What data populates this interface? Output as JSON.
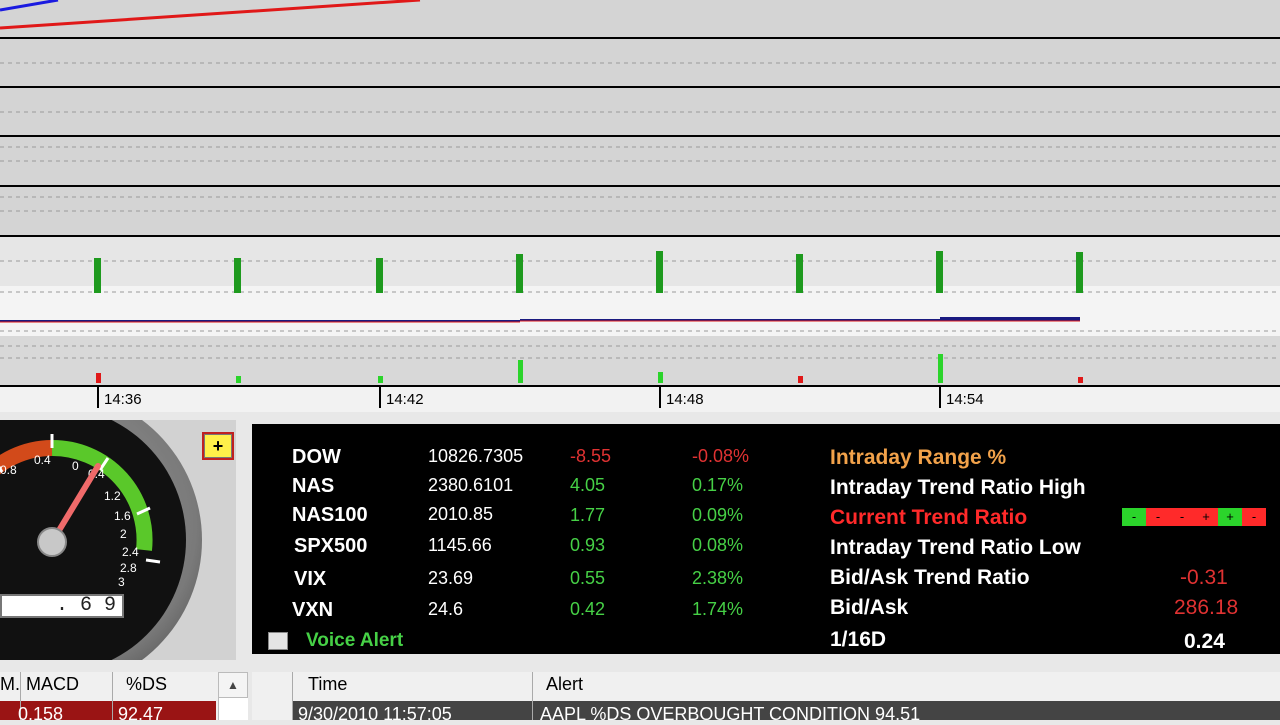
{
  "chart_data": {
    "type": "bar",
    "x_ticks": [
      "14:36",
      "14:42",
      "14:48",
      "14:54"
    ]
  },
  "gauge": {
    "readout": ". 6 9",
    "scale_labels": [
      "0.8",
      "0.4",
      "0",
      "0.4",
      "1.2",
      "1.6",
      "2",
      "2.4",
      "2.8",
      "3"
    ],
    "alarm_symbol": "+"
  },
  "market": {
    "rows": [
      {
        "symbol": "DOW",
        "value": "10826.7305",
        "change": "-8.55",
        "pct": "-0.08%",
        "direction": "down"
      },
      {
        "symbol": "NAS",
        "value": "2380.6101",
        "change": "4.05",
        "pct": "0.17%",
        "direction": "up"
      },
      {
        "symbol": "NAS100",
        "value": "2010.85",
        "change": "1.77",
        "pct": "0.09%",
        "direction": "up"
      },
      {
        "symbol": "SPX500",
        "value": "1145.66",
        "change": "0.93",
        "pct": "0.08%",
        "direction": "up"
      },
      {
        "symbol": "VIX",
        "value": "23.69",
        "change": "0.55",
        "pct": "2.38%",
        "direction": "up"
      },
      {
        "symbol": "VXN",
        "value": "24.6",
        "change": "0.42",
        "pct": "1.74%",
        "direction": "up"
      }
    ],
    "voice_alert_label": "Voice Alert",
    "stats": {
      "intraday_range": "Intraday Range %",
      "trend_high": "Intraday Trend Ratio High",
      "current_trend": "Current Trend Ratio",
      "trend_low": "Intraday Trend Ratio Low",
      "bid_ask_trend": "Bid/Ask Trend Ratio",
      "bid_ask_trend_value": "-0.31",
      "bid_ask": "Bid/Ask",
      "bid_ask_value": "286.18",
      "sixteenth": "1/16D",
      "sixteenth_value": "0.24"
    },
    "ratio_cells": [
      {
        "label": "-",
        "color": "#2bd42b"
      },
      {
        "label": "-",
        "color": "#ff2a2a"
      },
      {
        "label": "-",
        "color": "#ff2a2a"
      },
      {
        "label": "+",
        "color": "#ff2a2a"
      },
      {
        "label": "+",
        "color": "#2bd42b"
      },
      {
        "label": "-",
        "color": "#ff2a2a"
      }
    ]
  },
  "left_table": {
    "col0": "M.",
    "col1": "MACD",
    "col2": "%DS",
    "row1": {
      "macd": "0.158",
      "ds": "92.47"
    }
  },
  "alert_table": {
    "col_time": "Time",
    "col_alert": "Alert",
    "row1": {
      "time": "9/30/2010 11:57:05",
      "alert": "AAPL %DS OVERBOUGHT CONDITION 94.51"
    }
  },
  "colors": {
    "up": "#46d046",
    "down": "#e03232",
    "bar_green": "#1e9a1e",
    "line_red": "#e01818",
    "line_blue": "#1a1ae0"
  }
}
